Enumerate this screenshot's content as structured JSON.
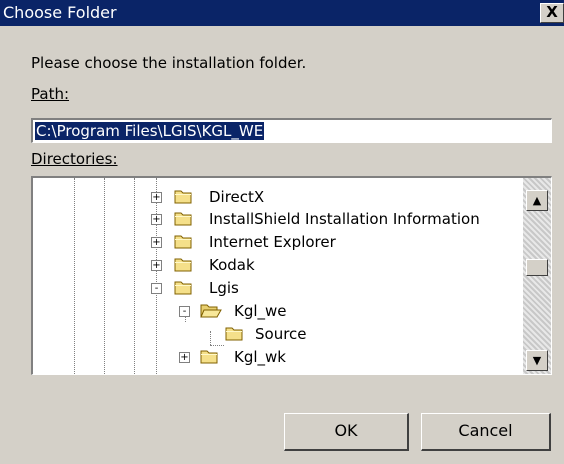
{
  "window": {
    "title": "Choose Folder",
    "close_glyph": "X"
  },
  "prompt": "Please choose the installation folder.",
  "path_label": "Path:",
  "path_value": "C:\\Program Files\\LGIS\\KGL_WE",
  "directories_label": "Directories:",
  "tree": {
    "items": [
      {
        "label": "DirectX",
        "expander": "+",
        "icon": "folder-closed-icon"
      },
      {
        "label": "InstallShield Installation Information",
        "expander": "+",
        "icon": "folder-closed-icon"
      },
      {
        "label": "Internet Explorer",
        "expander": "+",
        "icon": "folder-closed-icon"
      },
      {
        "label": "Kodak",
        "expander": "+",
        "icon": "folder-closed-icon"
      },
      {
        "label": "Lgis",
        "expander": "-",
        "icon": "folder-closed-icon"
      },
      {
        "label": "Kgl_we",
        "expander": "-",
        "icon": "folder-open-icon"
      },
      {
        "label": "Source",
        "expander": "",
        "icon": "folder-closed-icon"
      },
      {
        "label": "Kgl_wk",
        "expander": "+",
        "icon": "folder-closed-icon"
      }
    ]
  },
  "scrollbar": {
    "up_glyph": "▲",
    "down_glyph": "▼"
  },
  "buttons": {
    "ok": "OK",
    "cancel": "Cancel"
  }
}
